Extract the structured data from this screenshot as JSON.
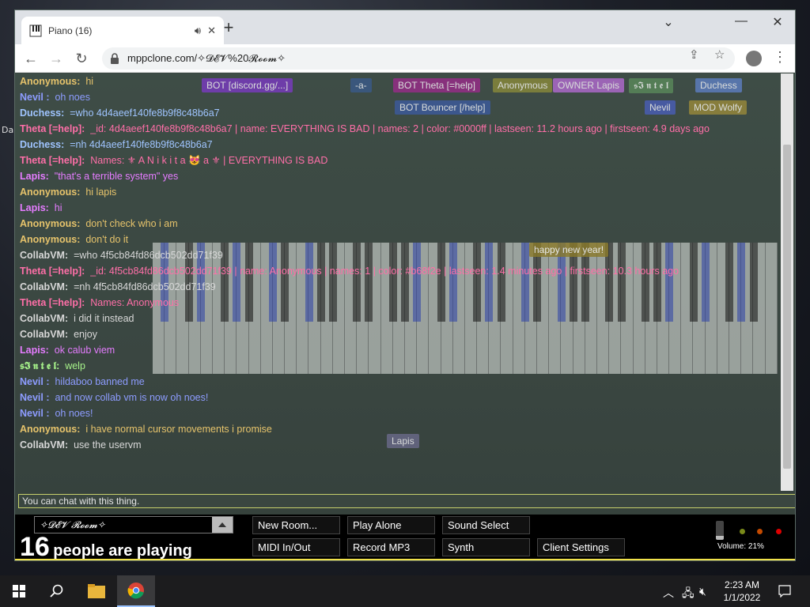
{
  "desktop": {
    "icon_label": "Da"
  },
  "browser": {
    "tab_title": "Piano (16)",
    "url": "mppclone.com/✧𝓓𝓔𝓥%20𝓡𝓸𝓸𝓶✧"
  },
  "participants": [
    {
      "label": "Anonymous",
      "color": "#8a8a3a"
    },
    {
      "label": "OWNER Lapis",
      "color": "#b36ad1"
    },
    {
      "label": "𝖘𝕴 𝖓 𝖙 𝖊 𝖑",
      "color": "#5a8a5a"
    },
    {
      "label": "Duchess",
      "color": "#5e7fc4"
    },
    {
      "label": "BOT [discord.gg/...]",
      "color": "#7a3ac2"
    },
    {
      "label": "BOT Theta [=help]",
      "color": "#9a2b8a"
    },
    {
      "label": "BOT Bouncer [/help]",
      "color": "#3c5a9e"
    },
    {
      "label": "Nevil",
      "color": "#4a5eb8"
    },
    {
      "label": "MOD Wolfy",
      "color": "#9a8a3a"
    },
    {
      "label": "-a-",
      "color": "#3a5a8a"
    },
    {
      "label": "happy new year!",
      "color": "#8a7a2a"
    },
    {
      "label": "Lapis",
      "color": "#6a6a8a"
    }
  ],
  "chat": [
    {
      "name": "Anonymous:",
      "text": "hi",
      "color": "#e6c36b"
    },
    {
      "name": "Nevil :",
      "text": "oh noes",
      "color": "#8d9cff"
    },
    {
      "name": "Duchess:",
      "text": "=who 4d4aeef140fe8b9f8c48b6a7",
      "color": "#9fc4ff"
    },
    {
      "name": "Theta [=help]:",
      "text": "_id: 4d4aeef140fe8b9f8c48b6a7 | name: EVERYTHING IS BAD | names: 2 | color: #0000ff | lastseen: 11.2 hours ago | firstseen: 4.9 days ago",
      "color": "#ff6fa8"
    },
    {
      "name": "Duchess:",
      "text": "=nh 4d4aeef140fe8b9f8c48b6a7",
      "color": "#9fc4ff"
    },
    {
      "name": "Theta [=help]:",
      "text": "Names: ⚜ A N i k i t a 😻 a ⚜ | EVERYTHING IS BAD",
      "color": "#ff6fa8"
    },
    {
      "name": "Lapis:",
      "text": "\"that's a terrible system\" yes",
      "color": "#e57cff"
    },
    {
      "name": "Anonymous:",
      "text": "hi lapis",
      "color": "#e6c36b"
    },
    {
      "name": "Lapis:",
      "text": "hi",
      "color": "#e57cff"
    },
    {
      "name": "Anonymous:",
      "text": "don't check who i am",
      "color": "#e6c36b"
    },
    {
      "name": "Anonymous:",
      "text": "don't do it",
      "color": "#e6c36b"
    },
    {
      "name": "CollabVM:",
      "text": "=who 4f5cb84fd86dcb502dd71f39",
      "color": "#d8d8d8"
    },
    {
      "name": "Theta [=help]:",
      "text": "_id: 4f5cb84fd86dcb502dd71f39 | name: Anonymous | names: 1 | color: #b68f2e | lastseen: 1.4 minutes ago | firstseen: 10.3 hours ago",
      "color": "#ff6fa8"
    },
    {
      "name": "CollabVM:",
      "text": "=nh 4f5cb84fd86dcb502dd71f39",
      "color": "#d8d8d8"
    },
    {
      "name": "Theta [=help]:",
      "text": "Names: Anonymous",
      "color": "#ff6fa8"
    },
    {
      "name": "CollabVM:",
      "text": "i did it instead",
      "color": "#d8d8d8"
    },
    {
      "name": "CollabVM:",
      "text": "enjoy",
      "color": "#d8d8d8"
    },
    {
      "name": "Lapis:",
      "text": "ok calub viem",
      "color": "#e57cff"
    },
    {
      "name": "𝖘𝕴 𝖓 𝖙 𝖊 𝖑:",
      "text": "welp",
      "color": "#a6f28a"
    },
    {
      "name": "Nevil :",
      "text": "hildaboo banned me",
      "color": "#8d9cff"
    },
    {
      "name": "Nevil :",
      "text": "and now collab vm is now oh noes!",
      "color": "#8d9cff"
    },
    {
      "name": "Nevil :",
      "text": "oh noes!",
      "color": "#8d9cff"
    },
    {
      "name": "Anonymous:",
      "text": "i have normal cursor movements i promise",
      "color": "#e6c36b"
    },
    {
      "name": "CollabVM:",
      "text": "use the uservm",
      "color": "#d8d8d8"
    }
  ],
  "chat_input": {
    "placeholder": "You can chat with this thing."
  },
  "bottom": {
    "room": "✧𝓓𝓔𝓥 𝓡𝓸𝓸𝓶✧",
    "people_count": "16",
    "people_text": "people are playing",
    "buttons": {
      "new_room": "New Room...",
      "play_alone": "Play Alone",
      "sound_select": "Sound Select",
      "midi": "MIDI In/Out",
      "record": "Record MP3",
      "synth": "Synth",
      "client_settings": "Client Settings"
    },
    "volume": "Volume: 21%",
    "volume_level": 0.21
  },
  "taskbar": {
    "time": "2:23 AM",
    "date": "1/1/2022"
  }
}
